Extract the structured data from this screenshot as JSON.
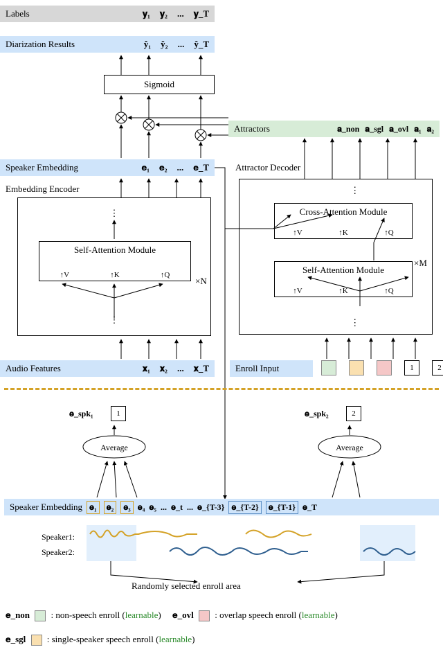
{
  "bands": {
    "labels": {
      "title": "Labels",
      "items": [
        "𝐲₁",
        "𝐲₂",
        "...",
        "𝐲_T"
      ]
    },
    "results": {
      "title": "Diarization Results",
      "items": [
        "ŷ₁",
        "ŷ₂",
        "...",
        "ŷ_T"
      ]
    },
    "attractors": {
      "title": "Attractors",
      "items": [
        "𝐚_non",
        "𝐚_sgl",
        "𝐚_ovl",
        "𝐚₁",
        "𝐚₂"
      ]
    },
    "speaker_emb": {
      "title": "Speaker Embedding",
      "items": [
        "𝐞₁",
        "𝐞₂",
        "...",
        "𝐞_T"
      ]
    },
    "audio_feat": {
      "title": "Audio Features",
      "items": [
        "𝐱₁",
        "𝐱₂",
        "...",
        "𝐱_T"
      ]
    },
    "enroll": {
      "title": "Enroll Input"
    },
    "speaker_emb2": {
      "title": "Speaker Embedding",
      "items": [
        "𝐞₁",
        "𝐞₂",
        "𝐞₃",
        "𝐞₄",
        "𝐞₅",
        "...",
        "𝐞_t",
        "...",
        "𝐞_{T-3}",
        "𝐞_{T-2}",
        "𝐞_{T-1}",
        "𝐞_T"
      ]
    }
  },
  "blocks": {
    "sigmoid": "Sigmoid",
    "encoder": {
      "title": "Embedding Encoder",
      "self_attn": "Self-Attention Module",
      "vkq": [
        "V",
        "K",
        "Q"
      ],
      "repeat": "×N"
    },
    "decoder": {
      "title": "Attractor Decoder",
      "cross_attn": "Cross-Attention Module",
      "self_attn": "Self-Attention Module",
      "vkq": [
        "V",
        "K",
        "Q"
      ],
      "repeat": "×M"
    }
  },
  "labels": {
    "spk1": "𝐞_spk₁",
    "spk2": "𝐞_spk₂",
    "avg": "Average",
    "enroll_nums": [
      "1",
      "2"
    ],
    "speaker1": "Speaker1:",
    "speaker2": "Speaker2:",
    "random": "Randomly selected enroll area"
  },
  "legend": {
    "enon": {
      "sym": "𝐞_non",
      "text": ": non-speech enroll (",
      "learn": "learnable",
      "close": ")"
    },
    "eovl": {
      "sym": "𝐞_ovl",
      "text": ": overlap speech enroll (",
      "learn": "learnable",
      "close": ")"
    },
    "esgl": {
      "sym": "𝐞_sgl",
      "text": ": single-speaker speech enroll (",
      "learn": "learnable",
      "close": ")"
    }
  },
  "colors": {
    "green": "#d7ecd7",
    "orange": "#fae0b0",
    "red": "#f5c7c7",
    "blueband": "#cfe4fa",
    "wave1": "#d4a227",
    "wave2": "#2f5f8f"
  }
}
